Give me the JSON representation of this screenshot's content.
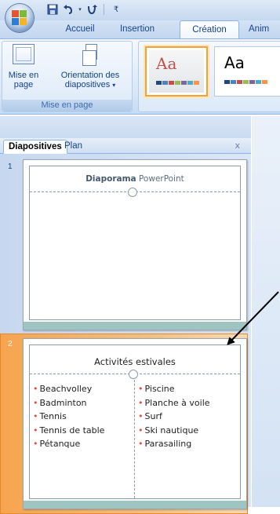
{
  "qat": {
    "save_icon": "save-icon",
    "undo_icon": "undo-icon",
    "redo_icon": "redo-icon"
  },
  "tabs": [
    "Accueil",
    "Insertion",
    "Création",
    "Anim"
  ],
  "active_tab": "Création",
  "ribbon": {
    "page_setup_label_1": "Mise en",
    "page_setup_label_2": "page",
    "orientation_label_1": "Orientation des",
    "orientation_label_2": "diapositives",
    "orientation_caret": "▾",
    "group_label": "Mise en page",
    "themes": [
      {
        "text": "Aa",
        "selected": true,
        "text_color": "#c0504d"
      },
      {
        "text": "Aa",
        "selected": false,
        "text_color": "#000000"
      }
    ]
  },
  "pane": {
    "tab_slides": "Diapositives",
    "tab_outline": "Plan",
    "close": "x"
  },
  "slides": [
    {
      "number": "1",
      "title_part1": "Diaporama",
      "title_part2": "PowerPoint"
    },
    {
      "number": "2",
      "title": "Activités estivales",
      "left_items": [
        "Beachvolley",
        "Badminton",
        "Tennis",
        "Tennis de table",
        "Pétanque"
      ],
      "right_items": [
        "Piscine",
        "Planche à voile",
        "Surf",
        "Ski nautique",
        "Parasailing"
      ]
    }
  ],
  "colors": {
    "accent_orange": "#f3a239",
    "ribbon_blue": "#15428b",
    "footer_teal": "#9fc5c2",
    "bullet_red": "#d8503a"
  }
}
